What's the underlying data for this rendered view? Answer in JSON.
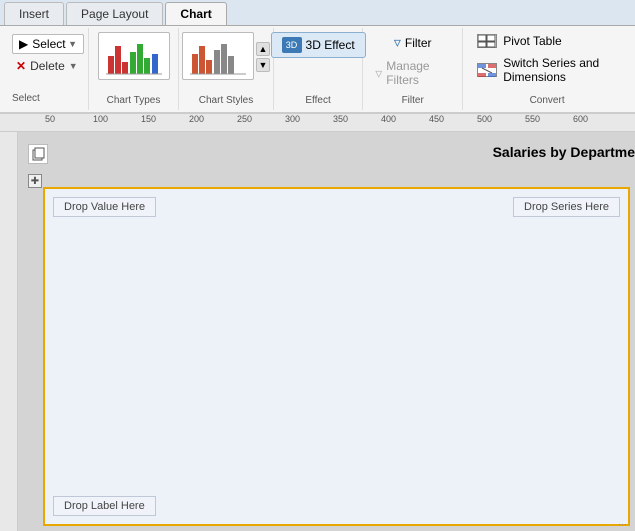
{
  "tabs": {
    "insert": "Insert",
    "page_layout": "Page Layout",
    "chart": "Chart"
  },
  "toolbar": {
    "select_group_label": "Select",
    "select_button_label": "Select",
    "delete_button_label": "Delete",
    "chart_types_label": "Chart Types",
    "chart_styles_label": "Chart Styles",
    "effect_label": "Effect",
    "effect_button_label": "3D Effect",
    "filter_label": "Filter",
    "filter_button_label": "Filter",
    "manage_filters_label": "Manage Filters",
    "convert_label": "Convert",
    "pivot_table_label": "Pivot Table",
    "switch_series_label": "Switch Series and Dimensions"
  },
  "ruler": {
    "marks": [
      "50",
      "100",
      "150",
      "200",
      "250",
      "300",
      "350",
      "400",
      "450",
      "500",
      "550",
      "600"
    ]
  },
  "chart": {
    "title": "Salaries by Departme",
    "drop_value": "Drop Value Here",
    "drop_series": "Drop Series Here",
    "drop_label": "Drop Label Here"
  }
}
